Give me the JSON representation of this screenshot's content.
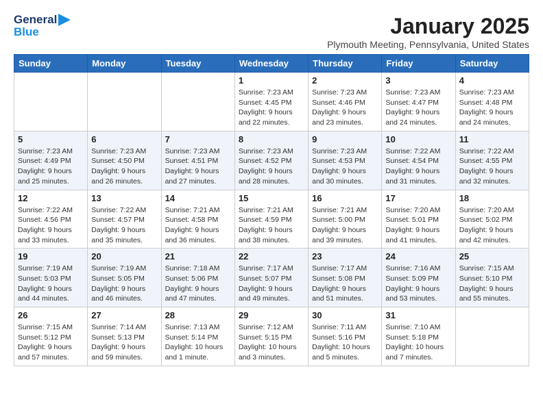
{
  "header": {
    "logo_line1": "General",
    "logo_line2": "Blue",
    "month_title": "January 2025",
    "location": "Plymouth Meeting, Pennsylvania, United States"
  },
  "weekdays": [
    "Sunday",
    "Monday",
    "Tuesday",
    "Wednesday",
    "Thursday",
    "Friday",
    "Saturday"
  ],
  "weeks": [
    [
      {
        "day": "",
        "info": ""
      },
      {
        "day": "",
        "info": ""
      },
      {
        "day": "",
        "info": ""
      },
      {
        "day": "1",
        "info": "Sunrise: 7:23 AM\nSunset: 4:45 PM\nDaylight: 9 hours\nand 22 minutes."
      },
      {
        "day": "2",
        "info": "Sunrise: 7:23 AM\nSunset: 4:46 PM\nDaylight: 9 hours\nand 23 minutes."
      },
      {
        "day": "3",
        "info": "Sunrise: 7:23 AM\nSunset: 4:47 PM\nDaylight: 9 hours\nand 24 minutes."
      },
      {
        "day": "4",
        "info": "Sunrise: 7:23 AM\nSunset: 4:48 PM\nDaylight: 9 hours\nand 24 minutes."
      }
    ],
    [
      {
        "day": "5",
        "info": "Sunrise: 7:23 AM\nSunset: 4:49 PM\nDaylight: 9 hours\nand 25 minutes."
      },
      {
        "day": "6",
        "info": "Sunrise: 7:23 AM\nSunset: 4:50 PM\nDaylight: 9 hours\nand 26 minutes."
      },
      {
        "day": "7",
        "info": "Sunrise: 7:23 AM\nSunset: 4:51 PM\nDaylight: 9 hours\nand 27 minutes."
      },
      {
        "day": "8",
        "info": "Sunrise: 7:23 AM\nSunset: 4:52 PM\nDaylight: 9 hours\nand 28 minutes."
      },
      {
        "day": "9",
        "info": "Sunrise: 7:23 AM\nSunset: 4:53 PM\nDaylight: 9 hours\nand 30 minutes."
      },
      {
        "day": "10",
        "info": "Sunrise: 7:22 AM\nSunset: 4:54 PM\nDaylight: 9 hours\nand 31 minutes."
      },
      {
        "day": "11",
        "info": "Sunrise: 7:22 AM\nSunset: 4:55 PM\nDaylight: 9 hours\nand 32 minutes."
      }
    ],
    [
      {
        "day": "12",
        "info": "Sunrise: 7:22 AM\nSunset: 4:56 PM\nDaylight: 9 hours\nand 33 minutes."
      },
      {
        "day": "13",
        "info": "Sunrise: 7:22 AM\nSunset: 4:57 PM\nDaylight: 9 hours\nand 35 minutes."
      },
      {
        "day": "14",
        "info": "Sunrise: 7:21 AM\nSunset: 4:58 PM\nDaylight: 9 hours\nand 36 minutes."
      },
      {
        "day": "15",
        "info": "Sunrise: 7:21 AM\nSunset: 4:59 PM\nDaylight: 9 hours\nand 38 minutes."
      },
      {
        "day": "16",
        "info": "Sunrise: 7:21 AM\nSunset: 5:00 PM\nDaylight: 9 hours\nand 39 minutes."
      },
      {
        "day": "17",
        "info": "Sunrise: 7:20 AM\nSunset: 5:01 PM\nDaylight: 9 hours\nand 41 minutes."
      },
      {
        "day": "18",
        "info": "Sunrise: 7:20 AM\nSunset: 5:02 PM\nDaylight: 9 hours\nand 42 minutes."
      }
    ],
    [
      {
        "day": "19",
        "info": "Sunrise: 7:19 AM\nSunset: 5:03 PM\nDaylight: 9 hours\nand 44 minutes."
      },
      {
        "day": "20",
        "info": "Sunrise: 7:19 AM\nSunset: 5:05 PM\nDaylight: 9 hours\nand 46 minutes."
      },
      {
        "day": "21",
        "info": "Sunrise: 7:18 AM\nSunset: 5:06 PM\nDaylight: 9 hours\nand 47 minutes."
      },
      {
        "day": "22",
        "info": "Sunrise: 7:17 AM\nSunset: 5:07 PM\nDaylight: 9 hours\nand 49 minutes."
      },
      {
        "day": "23",
        "info": "Sunrise: 7:17 AM\nSunset: 5:08 PM\nDaylight: 9 hours\nand 51 minutes."
      },
      {
        "day": "24",
        "info": "Sunrise: 7:16 AM\nSunset: 5:09 PM\nDaylight: 9 hours\nand 53 minutes."
      },
      {
        "day": "25",
        "info": "Sunrise: 7:15 AM\nSunset: 5:10 PM\nDaylight: 9 hours\nand 55 minutes."
      }
    ],
    [
      {
        "day": "26",
        "info": "Sunrise: 7:15 AM\nSunset: 5:12 PM\nDaylight: 9 hours\nand 57 minutes."
      },
      {
        "day": "27",
        "info": "Sunrise: 7:14 AM\nSunset: 5:13 PM\nDaylight: 9 hours\nand 59 minutes."
      },
      {
        "day": "28",
        "info": "Sunrise: 7:13 AM\nSunset: 5:14 PM\nDaylight: 10 hours\nand 1 minute."
      },
      {
        "day": "29",
        "info": "Sunrise: 7:12 AM\nSunset: 5:15 PM\nDaylight: 10 hours\nand 3 minutes."
      },
      {
        "day": "30",
        "info": "Sunrise: 7:11 AM\nSunset: 5:16 PM\nDaylight: 10 hours\nand 5 minutes."
      },
      {
        "day": "31",
        "info": "Sunrise: 7:10 AM\nSunset: 5:18 PM\nDaylight: 10 hours\nand 7 minutes."
      },
      {
        "day": "",
        "info": ""
      }
    ]
  ]
}
